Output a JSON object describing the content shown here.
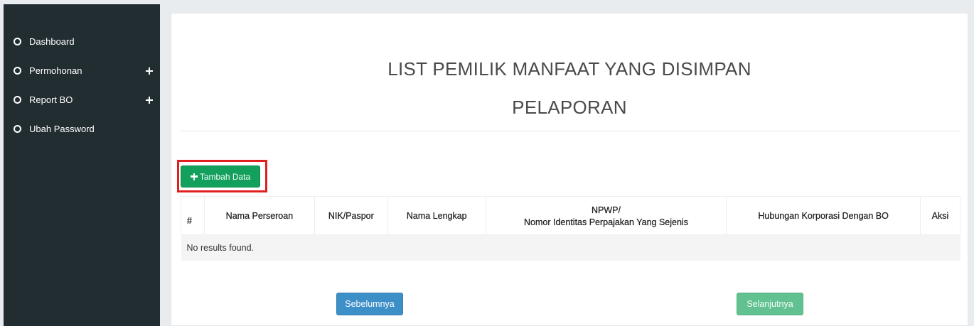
{
  "sidebar": {
    "items": [
      {
        "label": "Dashboard",
        "icon": "circle-icon",
        "expandable": false
      },
      {
        "label": "Permohonan",
        "icon": "circle-icon",
        "expandable": true
      },
      {
        "label": "Report BO",
        "icon": "circle-icon",
        "expandable": true
      },
      {
        "label": "Ubah Password",
        "icon": "circle-icon",
        "expandable": false
      }
    ]
  },
  "main": {
    "title_line1": "LIST PEMILIK MANFAAT YANG DISIMPAN",
    "title_line2": "PELAPORAN",
    "add_button_label": "Tambah Data",
    "table": {
      "headers": {
        "num": "#",
        "nama_perseroan": "Nama Perseroan",
        "nik_paspor": "NIK/Paspor",
        "nama_lengkap": "Nama Lengkap",
        "npwp_line1": "NPWP/",
        "npwp_line2": "Nomor Identitas Perpajakan Yang Sejenis",
        "hubungan": "Hubungan Korporasi Dengan BO",
        "aksi": "Aksi"
      },
      "empty_message": "No results found."
    },
    "pagination": {
      "prev_label": "Sebelumnya",
      "next_label": "Selanjutnya"
    }
  },
  "colors": {
    "sidebar_bg": "#222d32",
    "add_button": "#12a05c",
    "highlight_border": "#e0201f",
    "prev_button": "#3d8fc8",
    "next_button": "#62c191"
  }
}
